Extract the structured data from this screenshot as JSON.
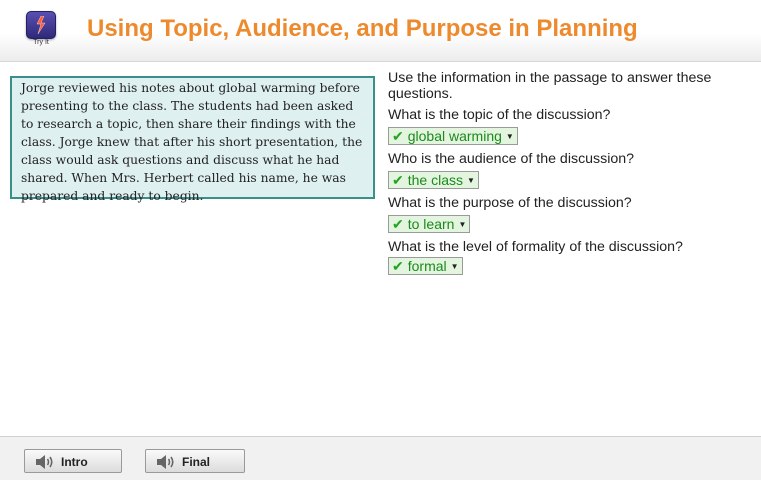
{
  "header": {
    "logo_caption": "Try It",
    "title": "Using Topic, Audience, and Purpose in Planning"
  },
  "passage": {
    "text": "Jorge reviewed his notes about global warming before presenting to the class. The students had been asked to research a topic, then share their findings with the class. Jorge knew that after his short presentation, the class would ask questions and discuss what he had shared. When Mrs. Herbert called his name, he was prepared and ready to begin."
  },
  "questions": {
    "instruction": "Use the information in the passage to answer these questions.",
    "items": [
      {
        "question": "What is the topic of the discussion?",
        "answer": "global warming"
      },
      {
        "question": "Who is the audience of the discussion?",
        "answer": "the class"
      },
      {
        "question": "What is the purpose of the discussion?",
        "answer": "to learn"
      },
      {
        "question": "What is the level of formality of the discussion?",
        "answer": "formal"
      }
    ]
  },
  "footer": {
    "intro_label": "Intro",
    "final_label": "Final"
  },
  "icons": {
    "check": "check-icon",
    "dropdown": "caret-down-icon",
    "speaker": "speaker-icon"
  },
  "colors": {
    "title": "#ee8a2e",
    "passage_border": "#3a8f8a",
    "passage_bg": "#dff0f0",
    "answer_text": "#1c8a1c",
    "answer_bg": "#e3f4df"
  }
}
